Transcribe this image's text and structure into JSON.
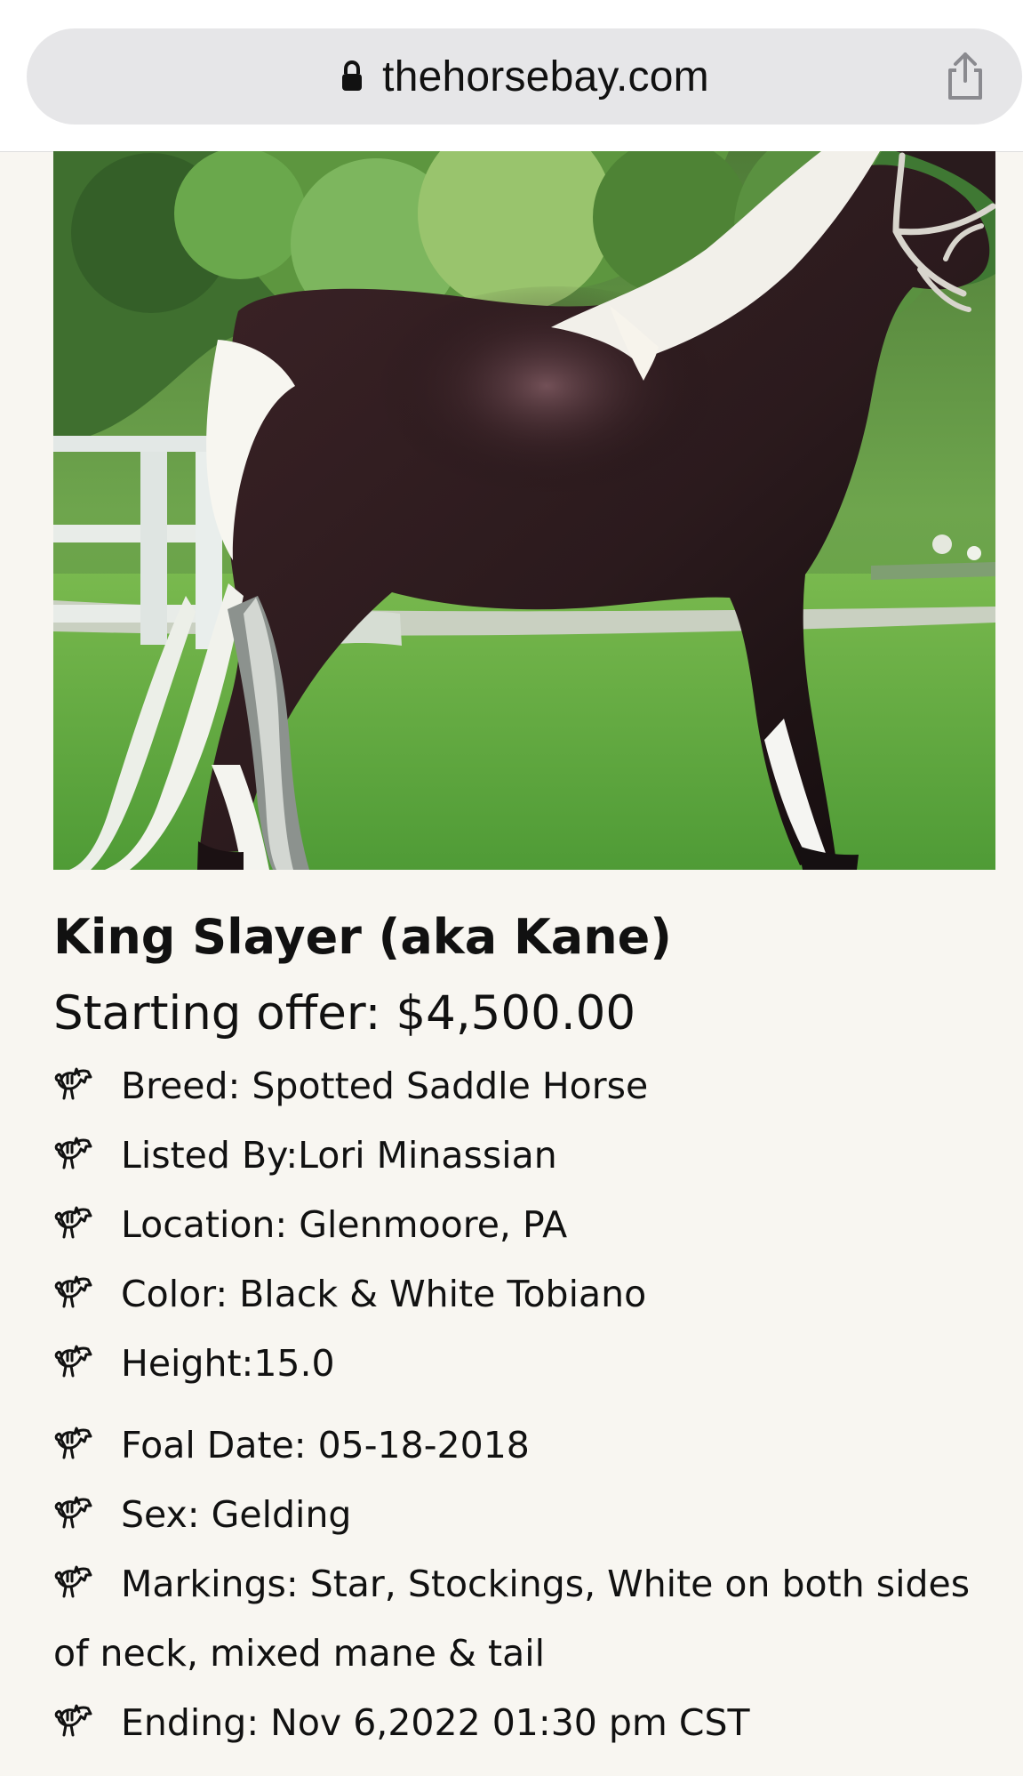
{
  "browser": {
    "url": "thehorsebay.com",
    "lock_icon": "lock-icon",
    "share_icon": "share-icon"
  },
  "listing": {
    "photo_icon": "horse-photo",
    "title": "King Slayer (aka Kane)",
    "starting_offer": "Starting offer: $4,500.00",
    "detail_icon": "horse-icon",
    "details": [
      {
        "text": "Breed: Spotted Saddle Horse"
      },
      {
        "text": "Listed By:Lori Minassian"
      },
      {
        "text": "Location: Glenmoore, PA"
      },
      {
        "text": "Color: Black & White Tobiano"
      },
      {
        "text": "Height:15.0"
      },
      {
        "text": "Foal Date: 05-18-2018"
      },
      {
        "text": "Sex: Gelding"
      },
      {
        "text": "Markings: Star, Stockings, White on both sides of neck, mixed mane & tail"
      },
      {
        "text": "Ending: Nov 6,2022 01:30 pm CST"
      }
    ]
  },
  "colors": {
    "page_background": "#f8f6f1",
    "address_bar": "#e6e6e8",
    "text": "#111111"
  }
}
